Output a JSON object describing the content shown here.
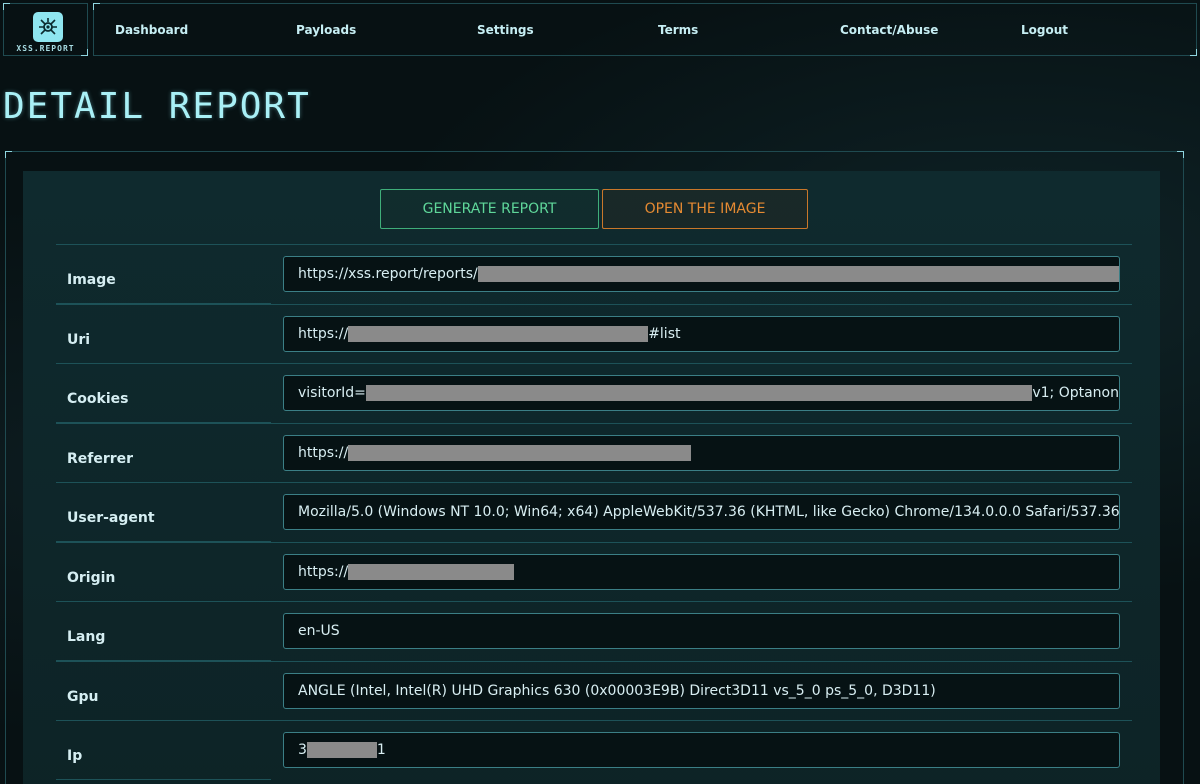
{
  "app": {
    "logo_text": "XSS.REPORT"
  },
  "nav": {
    "items": [
      {
        "label": "Dashboard"
      },
      {
        "label": "Payloads"
      },
      {
        "label": "Settings"
      },
      {
        "label": "Terms"
      },
      {
        "label": "Contact/Abuse"
      },
      {
        "label": "Logout"
      }
    ]
  },
  "page": {
    "title": "DETAIL REPORT"
  },
  "actions": {
    "generate_label": "GENERATE REPORT",
    "open_label": "OPEN THE IMAGE"
  },
  "fields": [
    {
      "label": "Image",
      "prefix": "https://xss.report/reports/",
      "redacted": true,
      "suffix": ""
    },
    {
      "label": "Uri",
      "prefix": "https://",
      "redacted": true,
      "suffix": "#list"
    },
    {
      "label": "Cookies",
      "prefix": "visitorId=",
      "redacted": true,
      "suffix": "v1; Optanon"
    },
    {
      "label": "Referrer",
      "prefix": "https://",
      "redacted": true,
      "suffix": ""
    },
    {
      "label": "User-agent",
      "prefix": "Mozilla/5.0 (Windows NT 10.0; Win64; x64) AppleWebKit/537.36 (KHTML, like Gecko) Chrome/134.0.0.0 Safari/537.36",
      "redacted": false,
      "suffix": ""
    },
    {
      "label": "Origin",
      "prefix": "https://",
      "redacted": true,
      "suffix": ""
    },
    {
      "label": "Lang",
      "prefix": "en-US",
      "redacted": false,
      "suffix": ""
    },
    {
      "label": "Gpu",
      "prefix": "ANGLE (Intel, Intel(R) UHD Graphics 630 (0x00003E9B) Direct3D11 vs_5_0 ps_5_0, D3D11)",
      "redacted": false,
      "suffix": ""
    },
    {
      "label": "Ip",
      "prefix": "3",
      "redacted": true,
      "suffix": "1"
    }
  ],
  "colors": {
    "accent": "#a9f0f6",
    "generate": "#5fd79a",
    "open": "#e58a32",
    "redaction": "#8a8a8a"
  }
}
